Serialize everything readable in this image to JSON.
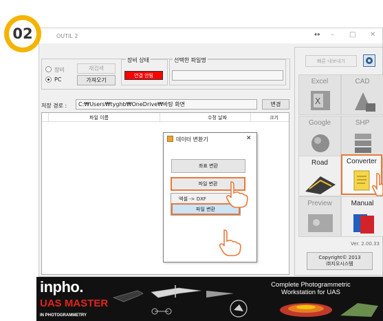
{
  "window": {
    "title": "OUTIL 2",
    "resize_icon": "↔",
    "minimize_icon": "–",
    "maximize_icon": "□",
    "close_icon": "✕"
  },
  "step_badge": "02",
  "equipment_group": {
    "radio_equipment": "장비",
    "radio_pc": "PC",
    "reset_btn": "재검색",
    "import_btn": "가져오기",
    "status_label": "장비 상태",
    "status_value": "연결 안됨",
    "status_color": "#ff0000",
    "filename_label": "선택한 파일명",
    "filename_value": ""
  },
  "save_path": {
    "label": "저장 경로 :",
    "value": "C:₩Users₩tyghb₩OneDrive₩바탕 화면",
    "change_btn": "변경"
  },
  "file_table": {
    "columns": [
      "파일 이름",
      "수정 날짜",
      "크기"
    ]
  },
  "right_panel": {
    "quick_export_btn": "빠른 내보내기",
    "settings_icon": "settings-icon",
    "tiles": [
      {
        "label": "Excel",
        "active": false
      },
      {
        "label": "CAD",
        "active": false
      },
      {
        "label": "Google",
        "active": false
      },
      {
        "label": "SHP",
        "active": false
      },
      {
        "label": "Road",
        "active": true
      },
      {
        "label": "Converter",
        "active": true
      },
      {
        "label": "Preview",
        "active": false
      },
      {
        "label": "Manual",
        "active": true
      }
    ],
    "version": "Ver. 2.00.33",
    "copyright_line1": "Copyright© 2013",
    "copyright_line2": "㈜지오시스템"
  },
  "dialog": {
    "title": "데이터 변환기",
    "close_icon": "✕",
    "coord_btn": "좌표 변환",
    "file_btn": "파일 변환"
  },
  "context_menu": {
    "item_excel_dxf": "엑셀 -> DXF",
    "item_file_convert": "파일 변환"
  },
  "banner": {
    "logo_text": "inpho.",
    "product_line1": "UAS MASTER",
    "product_line2": "IN PHOTOGRAMMETRY",
    "tagline_line1": "Complete Photogrammetric",
    "tagline_line2": "Workstation for UAS"
  },
  "colors": {
    "highlight": "#e8793a",
    "badge": "#f4b400"
  }
}
